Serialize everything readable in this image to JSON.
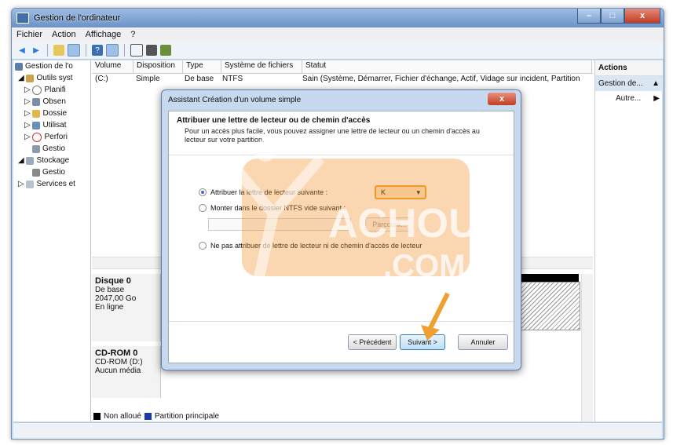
{
  "window": {
    "title": "Gestion de l'ordinateur",
    "controls": [
      "–",
      "□",
      "x"
    ]
  },
  "menu": [
    "Fichier",
    "Action",
    "Affichage",
    "?"
  ],
  "tree": [
    {
      "label": "Gestion de l'o",
      "level": 0
    },
    {
      "label": "Outils syst",
      "level": 1
    },
    {
      "label": "Planifi",
      "level": 2
    },
    {
      "label": "Obsen",
      "level": 2
    },
    {
      "label": "Dossie",
      "level": 2
    },
    {
      "label": "Utilisat",
      "level": 2
    },
    {
      "label": "Perfori",
      "level": 2
    },
    {
      "label": "Gestio",
      "level": 2
    },
    {
      "label": "Stockage",
      "level": 1
    },
    {
      "label": "Gestio",
      "level": 2
    },
    {
      "label": "Services et",
      "level": 1
    }
  ],
  "columns": [
    "Volume",
    "Disposition",
    "Type",
    "Système de fichiers",
    "Statut"
  ],
  "volume_row": {
    "volume": "(C:)",
    "disposition": "Simple",
    "type": "De base",
    "fs": "NTFS",
    "status": "Sain (Système, Démarrer, Fichier d'échange, Actif, Vidage sur incident, Partition"
  },
  "disks": [
    {
      "name": "Disque 0",
      "lines": [
        "De base",
        "2047,00 Go",
        "En ligne"
      ]
    },
    {
      "name": "CD-ROM 0",
      "lines": [
        "CD-ROM (D:)",
        "",
        "Aucun média"
      ]
    }
  ],
  "legend": {
    "unallocated": "Non alloué",
    "primary": "Partition principale"
  },
  "actions": {
    "header": "Actions",
    "selected": "Gestion de...",
    "item": "Autre..."
  },
  "dialog": {
    "title": "Assistant Création d'un volume simple",
    "close": "x",
    "heading": "Attribuer une lettre de lecteur ou de chemin d'accès",
    "subheading": "Pour un accès plus facile, vous pouvez assigner une lettre de lecteur ou un chemin d'accès au lecteur sur votre partition.",
    "option1": "Attribuer la lettre de lecteur suivante :",
    "option2": "Monter dans le dossier NTFS vide suivant :",
    "option3": "Ne pas attribuer de lettre de lecteur ni de chemin d'accès de lecteur",
    "drive_letter": "K",
    "browse": "Parcourir...",
    "back": "< Précédent",
    "next": "Suivant >",
    "cancel": "Annuler"
  },
  "watermark": {
    "line1": "ACHOURI",
    "line2": ".COM"
  },
  "colors": {
    "accent": "#f0a030",
    "title_gradient": "#6b93c8"
  }
}
